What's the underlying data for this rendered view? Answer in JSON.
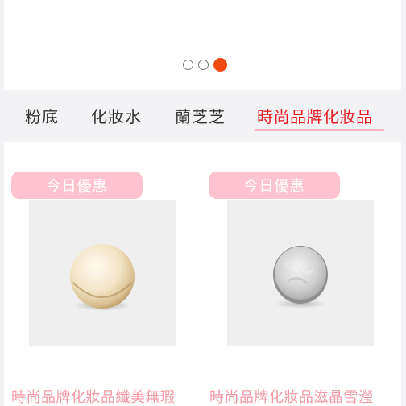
{
  "carousel": {
    "dots": [
      "inactive",
      "inactive",
      "active"
    ],
    "colors": {
      "active": "#f04a10",
      "inactive": "#ffffff"
    }
  },
  "tabs": [
    {
      "label": "粉底",
      "selected": false
    },
    {
      "label": "化妝水",
      "selected": false
    },
    {
      "label": "蘭芝芝",
      "selected": false
    },
    {
      "label": "時尚品牌化妝品",
      "selected": true
    }
  ],
  "products": [
    {
      "badge": "今日優惠",
      "image_icon": "cushion-compact-gold-icon",
      "title": "時尚品牌化妝品纖美無瑕"
    },
    {
      "badge": "今日優惠",
      "image_icon": "cushion-compact-silver-icon",
      "title": "時尚品牌化妝品滋晶雪瀅"
    }
  ],
  "colors": {
    "accent": "#e8191f",
    "badge_bg": "#ffc3cf",
    "title_pink": "#f39aa4"
  }
}
